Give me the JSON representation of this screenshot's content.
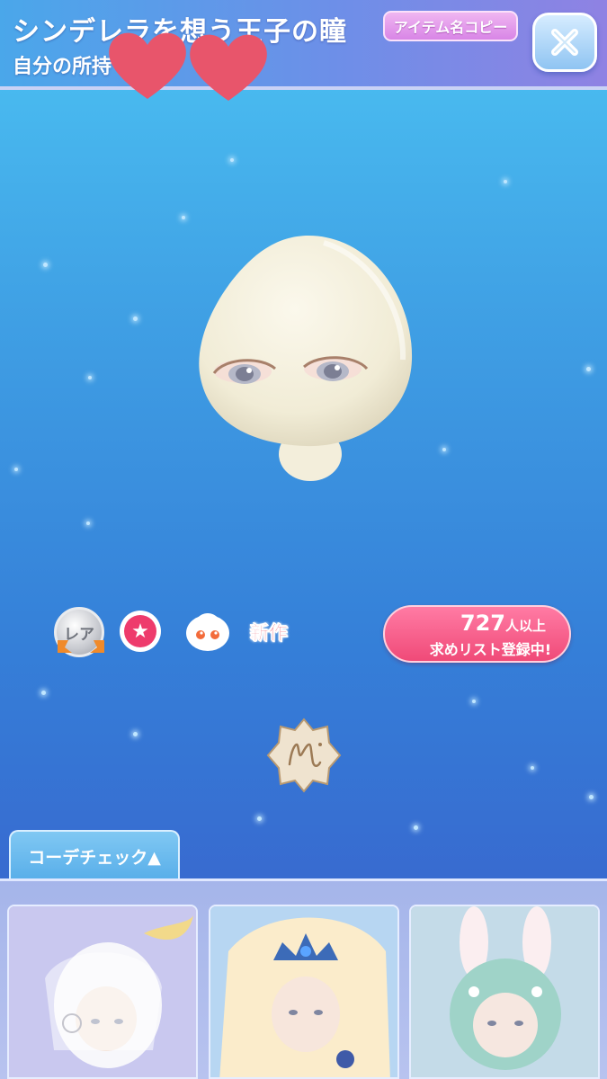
{
  "header": {
    "title": "シンデレラを想う王子の瞳",
    "subtitle": "自分の所持",
    "copy_button_label": "アイテム名コピー",
    "close_icon": "close-icon"
  },
  "item": {
    "icon": "eyes-item-preview"
  },
  "badges": {
    "rarity_label": "レア",
    "new_label": "新作",
    "wishlist_count": "727",
    "wishlist_count_suffix": "人以上",
    "wishlist_text": "求めリスト登録中!"
  },
  "coordinate": {
    "tab_label": "コーデチェック▲"
  },
  "colors": {
    "background_top": "#4cc3f3",
    "background_bottom": "#3a59c9",
    "wish_pill": "#f04a78",
    "accent_red": "#e5263d"
  }
}
